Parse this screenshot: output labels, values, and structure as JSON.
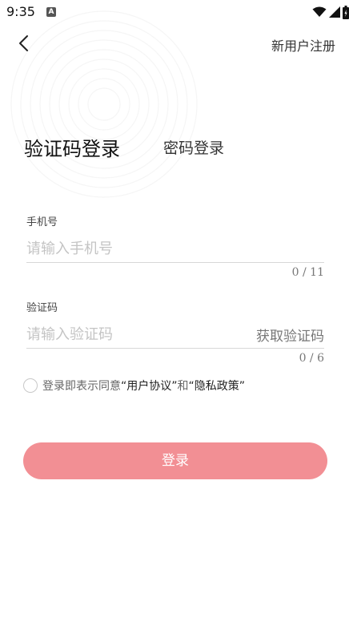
{
  "status_bar": {
    "time": "9:35",
    "notification_badge": "A"
  },
  "header": {
    "back_icon": "chevron-left-icon",
    "register_label": "新用户注册"
  },
  "tabs": {
    "sms_login": "验证码登录",
    "password_login": "密码登录"
  },
  "phone": {
    "label": "手机号",
    "placeholder": "请输入手机号",
    "counter": "0 / 11"
  },
  "code": {
    "label": "验证码",
    "placeholder": "请输入验证码",
    "get_code": "获取验证码",
    "counter": "0 / 6"
  },
  "agreement": {
    "prefix": "登录即表示同意",
    "user_agreement": "“用户协议”",
    "and": "和",
    "privacy_policy": "“隐私政策”"
  },
  "login": {
    "label": "登录"
  },
  "colors": {
    "login_button": "#f28f94",
    "placeholder": "#c4c4c4"
  }
}
